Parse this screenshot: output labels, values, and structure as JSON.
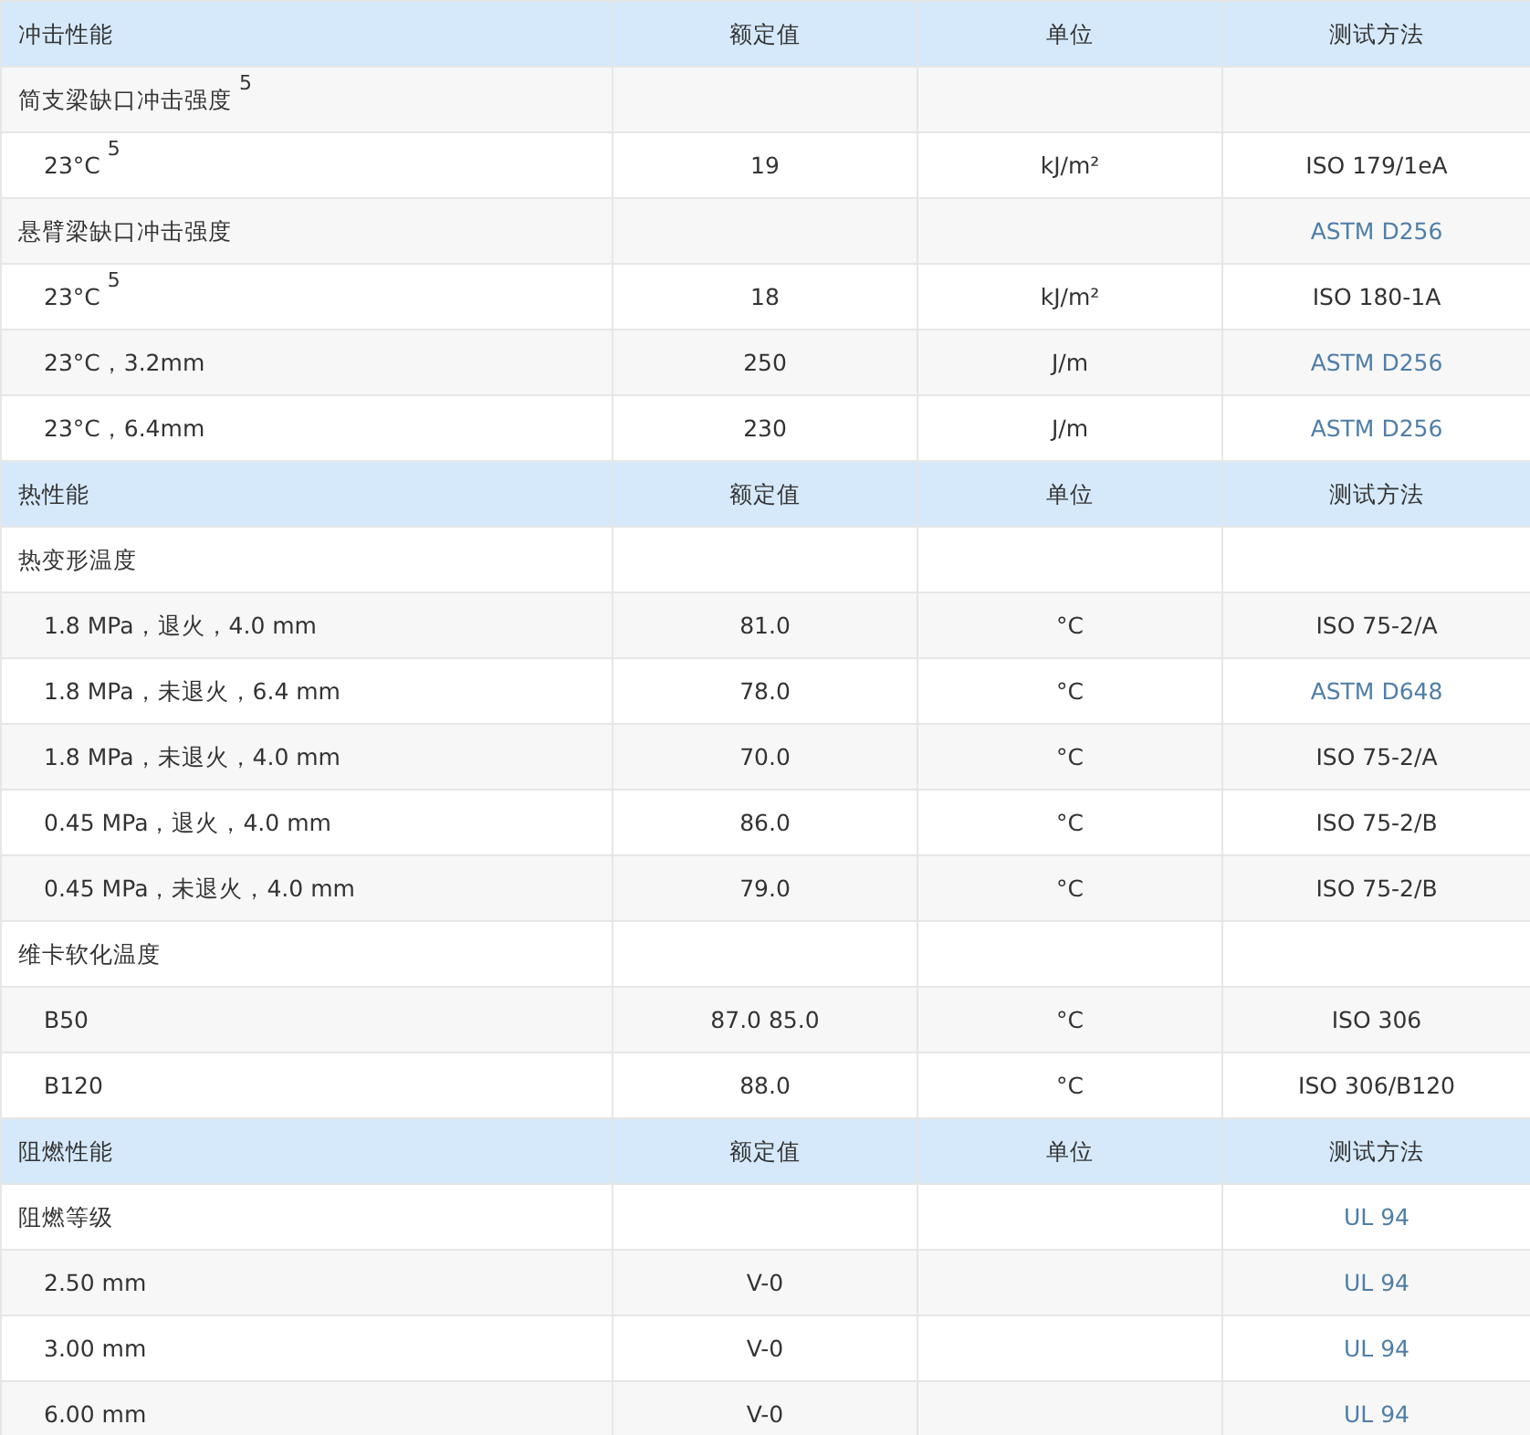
{
  "table": {
    "rows": [
      {
        "kind": "header",
        "cells": [
          "冲击性能",
          "额定值",
          "单位",
          "测试方法"
        ]
      },
      {
        "kind": "group",
        "cells": [
          "简支梁缺口冲击强度 $^{5}$",
          "",
          "",
          ""
        ]
      },
      {
        "kind": "sub",
        "cells": [
          "23°C $^{5}$",
          "19",
          "kJ/m²",
          "ISO 179/1eA"
        ]
      },
      {
        "kind": "group",
        "cells": [
          "悬臂梁缺口冲击强度",
          "",
          "",
          "ASTM D256"
        ],
        "link": true
      },
      {
        "kind": "sub",
        "cells": [
          "23°C $^{5}$",
          "18",
          "kJ/m²",
          "ISO 180-1A"
        ]
      },
      {
        "kind": "sub",
        "cells": [
          "23°C，3.2mm",
          "250",
          "J/m",
          "ASTM D256"
        ],
        "link": true
      },
      {
        "kind": "sub",
        "cells": [
          "23°C，6.4mm",
          "230",
          "J/m",
          "ASTM D256"
        ],
        "link": true
      },
      {
        "kind": "header",
        "cells": [
          "热性能",
          "额定值",
          "单位",
          "测试方法"
        ]
      },
      {
        "kind": "group",
        "cells": [
          "热变形温度",
          "",
          "",
          ""
        ]
      },
      {
        "kind": "sub",
        "cells": [
          "1.8 MPa，退火，4.0 mm",
          "81.0",
          "°C",
          "ISO 75-2/A"
        ]
      },
      {
        "kind": "sub",
        "cells": [
          "1.8 MPa，未退火，6.4 mm",
          "78.0",
          "°C",
          "ASTM D648"
        ],
        "link": true
      },
      {
        "kind": "sub",
        "cells": [
          "1.8 MPa，未退火，4.0 mm",
          "70.0",
          "°C",
          "ISO 75-2/A"
        ]
      },
      {
        "kind": "sub",
        "cells": [
          "0.45 MPa，退火，4.0 mm",
          "86.0",
          "°C",
          "ISO 75-2/B"
        ]
      },
      {
        "kind": "sub",
        "cells": [
          "0.45 MPa，未退火，4.0 mm",
          "79.0",
          "°C",
          "ISO 75-2/B"
        ]
      },
      {
        "kind": "group",
        "cells": [
          "维卡软化温度",
          "",
          "",
          ""
        ]
      },
      {
        "kind": "sub",
        "cells": [
          "B50",
          "87.0 85.0",
          "°C",
          "ISO 306"
        ]
      },
      {
        "kind": "sub",
        "cells": [
          "B120",
          "88.0",
          "°C",
          "ISO 306/B120"
        ]
      },
      {
        "kind": "header",
        "cells": [
          "阻燃性能",
          "额定值",
          "单位",
          "测试方法"
        ]
      },
      {
        "kind": "group",
        "cells": [
          "阻燃等级",
          "",
          "",
          "UL 94"
        ],
        "link": true
      },
      {
        "kind": "sub",
        "cells": [
          "2.50 mm",
          "V-0",
          "",
          "UL 94"
        ],
        "link": true
      },
      {
        "kind": "sub",
        "cells": [
          "3.00 mm",
          "V-0",
          "",
          "UL 94"
        ],
        "link": true
      },
      {
        "kind": "sub",
        "cells": [
          "6.00 mm",
          "V-0",
          "",
          "UL 94"
        ],
        "link": true
      }
    ]
  }
}
